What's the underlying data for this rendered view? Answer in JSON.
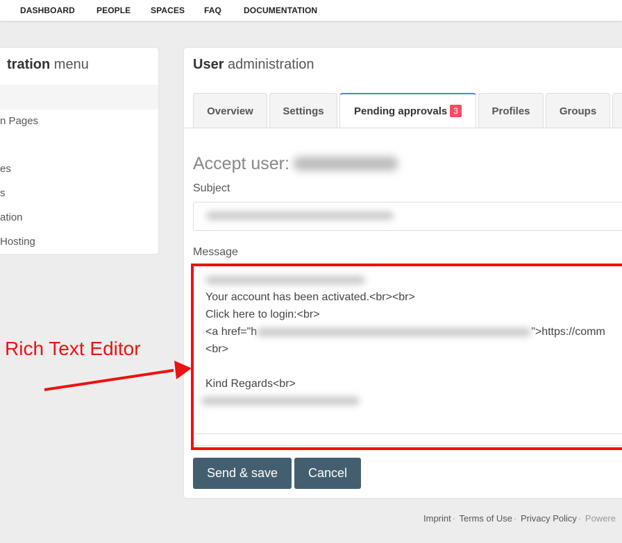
{
  "top_nav": {
    "items": [
      {
        "label": "DASHBOARD"
      },
      {
        "label": "PEOPLE"
      },
      {
        "label": "SPACES"
      },
      {
        "label": "FAQ"
      },
      {
        "label": "DOCUMENTATION"
      }
    ]
  },
  "sidebar": {
    "title_bold": "tration",
    "title_rest": "menu",
    "items": [
      {
        "label": "n Pages"
      },
      {
        "label": "es"
      },
      {
        "label": "s"
      },
      {
        "label": "ation"
      },
      {
        "label": "Hosting"
      }
    ]
  },
  "main": {
    "title_bold": "User",
    "title_rest": "administration",
    "tabs": [
      {
        "label": "Overview"
      },
      {
        "label": "Settings"
      },
      {
        "label": "Pending approvals",
        "badge": "3",
        "active": true
      },
      {
        "label": "Profiles"
      },
      {
        "label": "Groups"
      }
    ],
    "accept_title": "Accept user:",
    "subject_label": "Subject",
    "message_label": "Message",
    "message_lines": {
      "line2": "Your account has been activated.<br><br>",
      "line3": "Click here to login:<br>",
      "line4_prefix": "<a href=\"h",
      "line4_suffix": "\">https://comm",
      "line5": "<br>",
      "line7": "Kind Regards<br>"
    },
    "buttons": {
      "send": "Send & save",
      "cancel": "Cancel"
    }
  },
  "annotation": {
    "label": "Rich Text Editor",
    "color": "#ee1111"
  },
  "footer": {
    "imprint": "Imprint",
    "terms": "Terms of Use",
    "privacy": "Privacy Policy",
    "powered": "Powere"
  },
  "colors": {
    "accent": "#21a1b3",
    "badge": "#fc4a64",
    "button": "#435f6f"
  }
}
